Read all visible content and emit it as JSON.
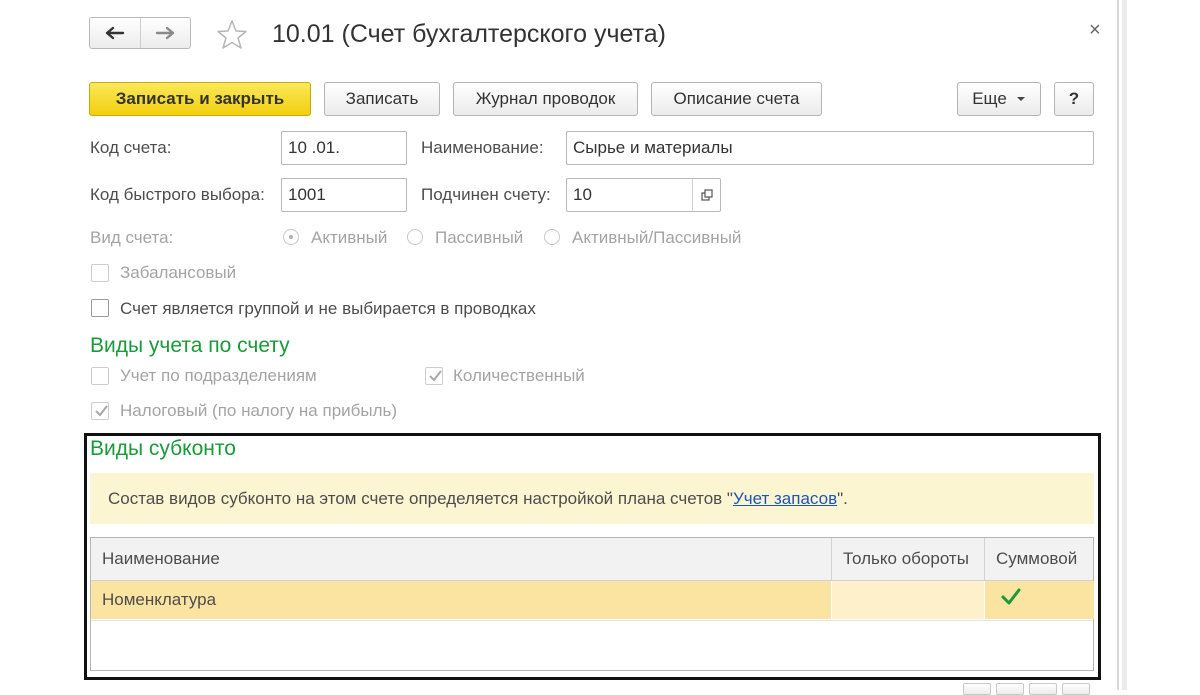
{
  "window": {
    "title": "10.01 (Счет бухгалтерского учета)",
    "close_symbol": "×"
  },
  "icons": {
    "back": "arrow-left-icon",
    "forward": "arrow-right-icon",
    "favorite": "star-icon",
    "close": "close-icon",
    "dropdown": "chevron-down-icon",
    "open": "open-form-icon",
    "check": "checkmark-icon"
  },
  "toolbar": {
    "save_close": "Записать и закрыть",
    "save": "Записать",
    "journal": "Журнал проводок",
    "description": "Описание счета",
    "more": "Еще",
    "help": "?"
  },
  "form": {
    "code_label": "Код счета:",
    "code_value": "10 .01.",
    "name_label": "Наименование:",
    "name_value": "Сырье и материалы",
    "quick_label": "Код быстрого выбора:",
    "quick_value": "1001",
    "parent_label": "Подчинен счету:",
    "parent_value": "10",
    "type_label": "Вид счета:",
    "type_options": [
      "Активный",
      "Пассивный",
      "Активный/Пассивный"
    ],
    "type_selected": "Активный",
    "offbalance_label": "Забалансовый",
    "offbalance_checked": false,
    "group_label": "Счет является группой и не выбирается в проводках",
    "group_checked": false
  },
  "accounting_kinds": {
    "title": "Виды учета по счету",
    "by_division_label": "Учет по подразделениям",
    "by_division_checked": false,
    "quantity_label": "Количественный",
    "quantity_checked": true,
    "tax_label": "Налоговый (по налогу на прибыль)",
    "tax_checked": true
  },
  "subconto": {
    "title": "Виды субконто",
    "info_prefix": "Состав видов субконто на этом счете определяется настройкой плана счетов \"",
    "info_link": "Учет запасов",
    "info_suffix": "\".",
    "columns": [
      "Наименование",
      "Только обороты",
      "Суммовой"
    ],
    "rows": [
      {
        "name": "Номенклатура",
        "turnover_only": false,
        "sum": true
      }
    ]
  },
  "colors": {
    "primary_button": "#f5d318",
    "section_title": "#1a9a3a",
    "info_background": "#fbf5d2",
    "selected_row": "#fbe3a1",
    "link": "#1e55b5",
    "check": "#1a9a3a"
  }
}
